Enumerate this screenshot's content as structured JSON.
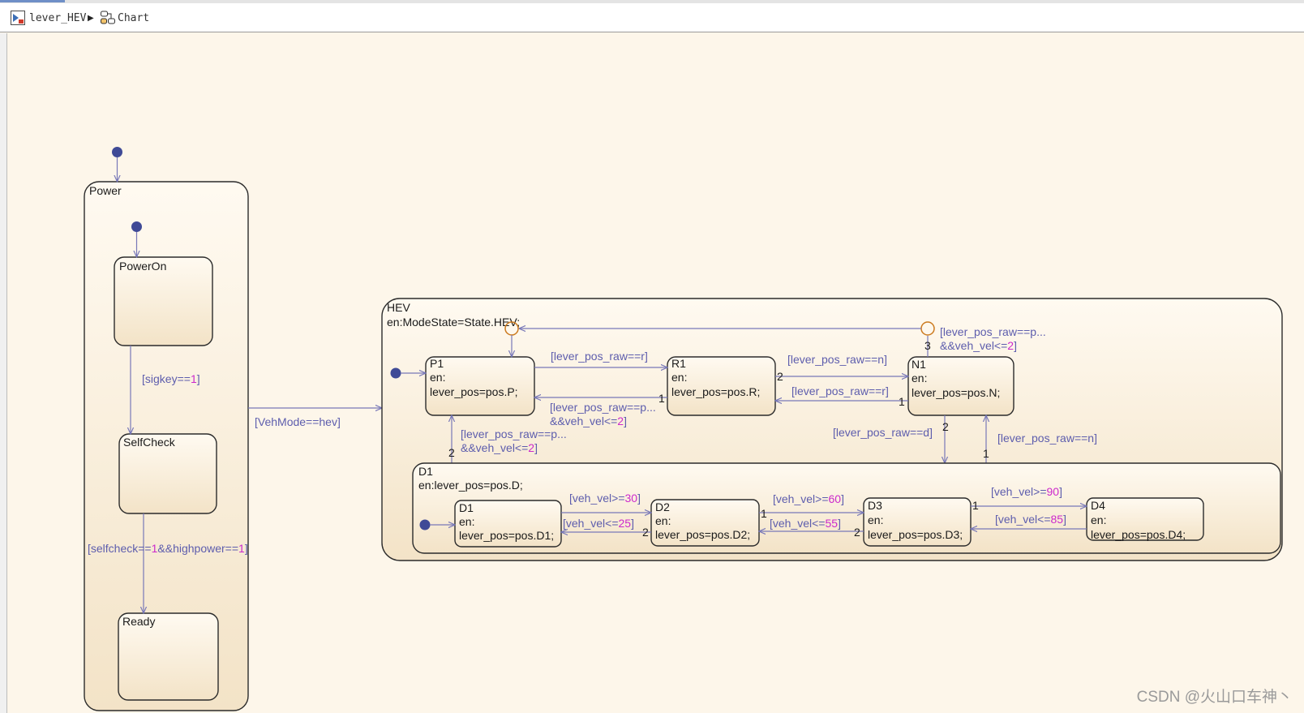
{
  "breadcrumb": {
    "model": "lever_HEV",
    "chart": "Chart"
  },
  "states": {
    "power": {
      "name": "Power"
    },
    "power_on": {
      "name": "PowerOn"
    },
    "self_check": {
      "name": "SelfCheck"
    },
    "ready": {
      "name": "Ready"
    },
    "hev": {
      "name": "HEV",
      "entry": "en:ModeState=State.HEV;"
    },
    "p1": {
      "name": "P1",
      "en": "en:",
      "action": "lever_pos=pos.P;"
    },
    "r1": {
      "name": "R1",
      "en": "en:",
      "action": "lever_pos=pos.R;"
    },
    "n1": {
      "name": "N1",
      "en": "en:",
      "action": "lever_pos=pos.N;"
    },
    "d1_super": {
      "name": "D1",
      "entry": "en:lever_pos=pos.D;"
    },
    "d1": {
      "name": "D1",
      "en": "en:",
      "action": "lever_pos=pos.D1;"
    },
    "d2": {
      "name": "D2",
      "en": "en:",
      "action": "lever_pos=pos.D2;"
    },
    "d3": {
      "name": "D3",
      "en": "en:",
      "action": "lever_pos=pos.D3;"
    },
    "d4": {
      "name": "D4",
      "en": "en:",
      "action": "lever_pos=pos.D4;"
    }
  },
  "transitions": {
    "sigkey": {
      "pre": "[sigkey==",
      "num": "1",
      "post": "]"
    },
    "selfcheck": {
      "pre": "[selfcheck==",
      "num1": "1",
      "mid": "&&highpower==",
      "num2": "1",
      "post": "]"
    },
    "vehmode": "[VehMode==hev]",
    "p_to_r": "[lever_pos_raw==r]",
    "r_to_p": {
      "line1": "[lever_pos_raw==p...",
      "line2_pre": "&&veh_vel<=",
      "num": "2",
      "line2_post": "]"
    },
    "r_to_n": "[lever_pos_raw==n]",
    "n_to_r": "[lever_pos_raw==r]",
    "n_to_p": {
      "line1": "[lever_pos_raw==p...",
      "line2_pre": "&&veh_vel<=",
      "num": "2",
      "line2_post": "]"
    },
    "d_to_p": {
      "line1": "[lever_pos_raw==p...",
      "line2_pre": "&&veh_vel<=",
      "num": "2",
      "line2_post": "]"
    },
    "n_to_d": "[lever_pos_raw==d]",
    "d_to_n": "[lever_pos_raw==n]",
    "d1_to_d2": {
      "pre": "[veh_vel>=",
      "num": "30",
      "post": "]"
    },
    "d2_to_d1": {
      "pre": "[veh_vel<=",
      "num": "25",
      "post": "]"
    },
    "d2_to_d3": {
      "pre": "[veh_vel>=",
      "num": "60",
      "post": "]"
    },
    "d3_to_d2": {
      "pre": "[veh_vel<=",
      "num": "55",
      "post": "]"
    },
    "d3_to_d4": {
      "pre": "[veh_vel>=",
      "num": "90",
      "post": "]"
    },
    "d4_to_d3": {
      "pre": "[veh_vel<=",
      "num": "85",
      "post": "]"
    }
  },
  "orders": {
    "r_out_p": "1",
    "r_out_n": "2",
    "n_out_r": "1",
    "n_out_p": "3",
    "n_out_d": "2",
    "d_out_p": "2",
    "d_out_n": "1",
    "d2_out_d1": "2",
    "d2_out_d3": "1",
    "d3_out_d2": "2",
    "d3_out_d4": "1"
  },
  "watermark": "CSDN @火山口车神丶",
  "colors": {
    "canvas": "#fdf6ea",
    "state_top": "#fffaf1",
    "state_bottom": "#f3e3c7",
    "transition": "#7878b8",
    "condition_text": "#5d5dad",
    "number": "#cc29cc",
    "default_dot": "#3f4a96",
    "junction": "#cc7a1e"
  },
  "icons": {
    "model": "simulink-model-icon",
    "chart": "stateflow-chart-icon",
    "separator": "triangle-right-icon"
  }
}
